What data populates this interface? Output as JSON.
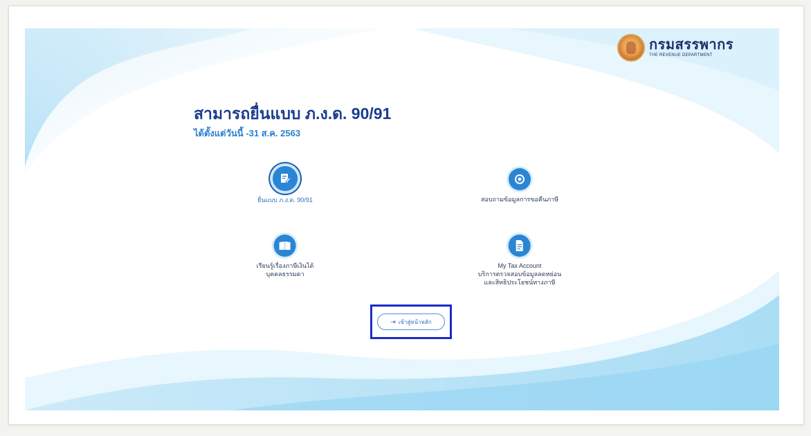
{
  "logo": {
    "thai_name": "กรมสรรพากร",
    "english_name": "THE REVENUE DEPARTMENT"
  },
  "heading": {
    "title": "สามารถยื่นแบบ ภ.ง.ด. 90/91",
    "subtitle": "ได้ตั้งแต่วันนี้ -31 ส.ค. 2563"
  },
  "services": [
    {
      "icon": "file-edit-icon",
      "label": "ยื่นแบบ ภ.ง.ด. 90/91"
    },
    {
      "icon": "refresh-money-icon",
      "label": "สอบถามข้อมูลการขอคืนภาษี"
    },
    {
      "icon": "book-icon",
      "line1": "เรียนรู้เรื่องภาษีเงินได้",
      "line2": "บุคคลธรรมดา"
    },
    {
      "icon": "document-icon",
      "line1": "My Tax Account",
      "line2": "บริการตรวจสอบข้อมูลลดหย่อน",
      "line3": "และสิทธิประโยชน์ทางภาษี"
    }
  ],
  "home_button": {
    "label": "เข้าสู่หน้าหลัก",
    "icon": "login-icon"
  },
  "colors": {
    "accent": "#2a85d4",
    "heading": "#1b3d8f",
    "highlight_box": "#1a2cc9"
  }
}
